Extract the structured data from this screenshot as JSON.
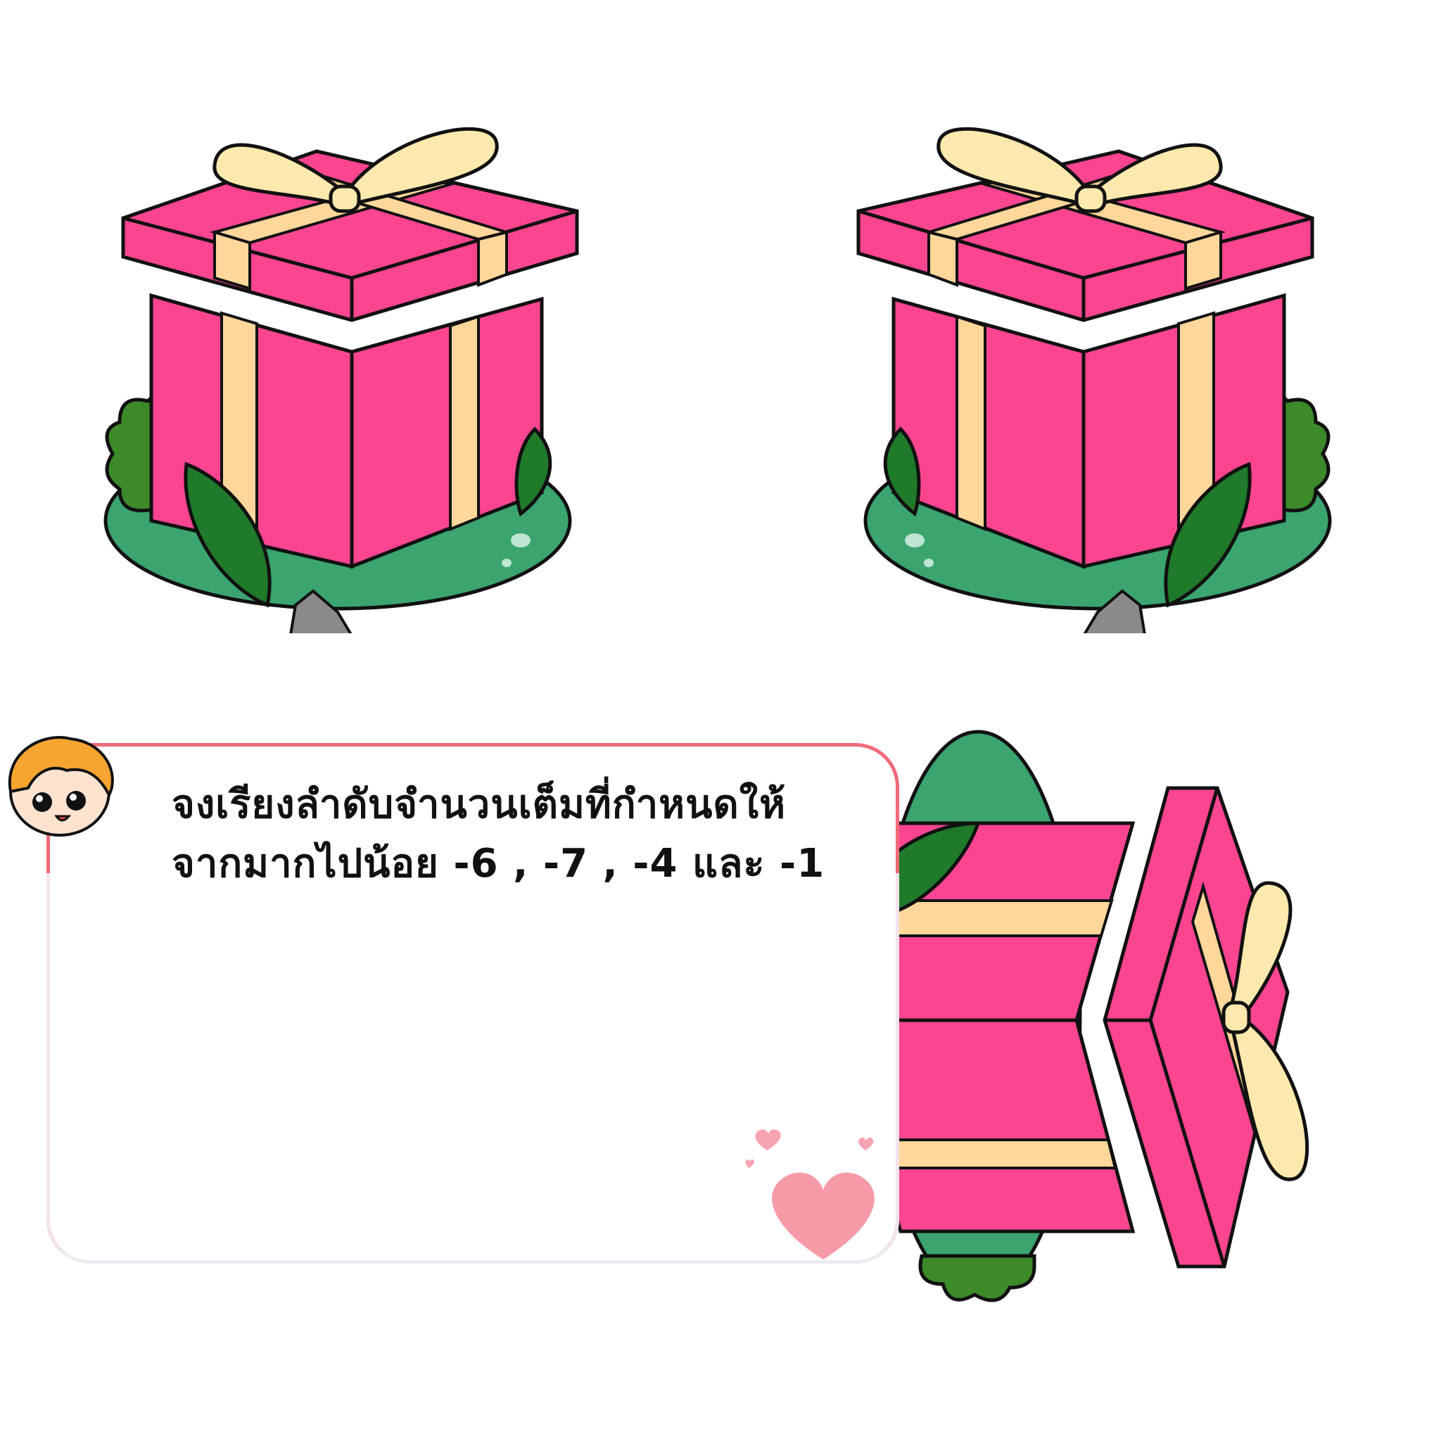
{
  "instruction": {
    "line1": "จงเรียงลำดับจำนวนเต็มที่กำหนดให้",
    "line2": "จากมากไปน้อย -6 , -7 , -4 และ -1"
  },
  "colors": {
    "gift_pink": "#fb4590",
    "ribbon": "#ffd79a",
    "bow": "#fde9ad",
    "grass": "#3ba46f",
    "bush": "#3d8a2b",
    "leaf": "#1f7a2a",
    "rock": "#8a8a8a",
    "card_border": "#f06a78",
    "avatar_hair": "#f7a531",
    "heart": "#f79aa8"
  },
  "icons": [
    "gift-box-icon",
    "boy-avatar-icon",
    "hearts-icon"
  ]
}
